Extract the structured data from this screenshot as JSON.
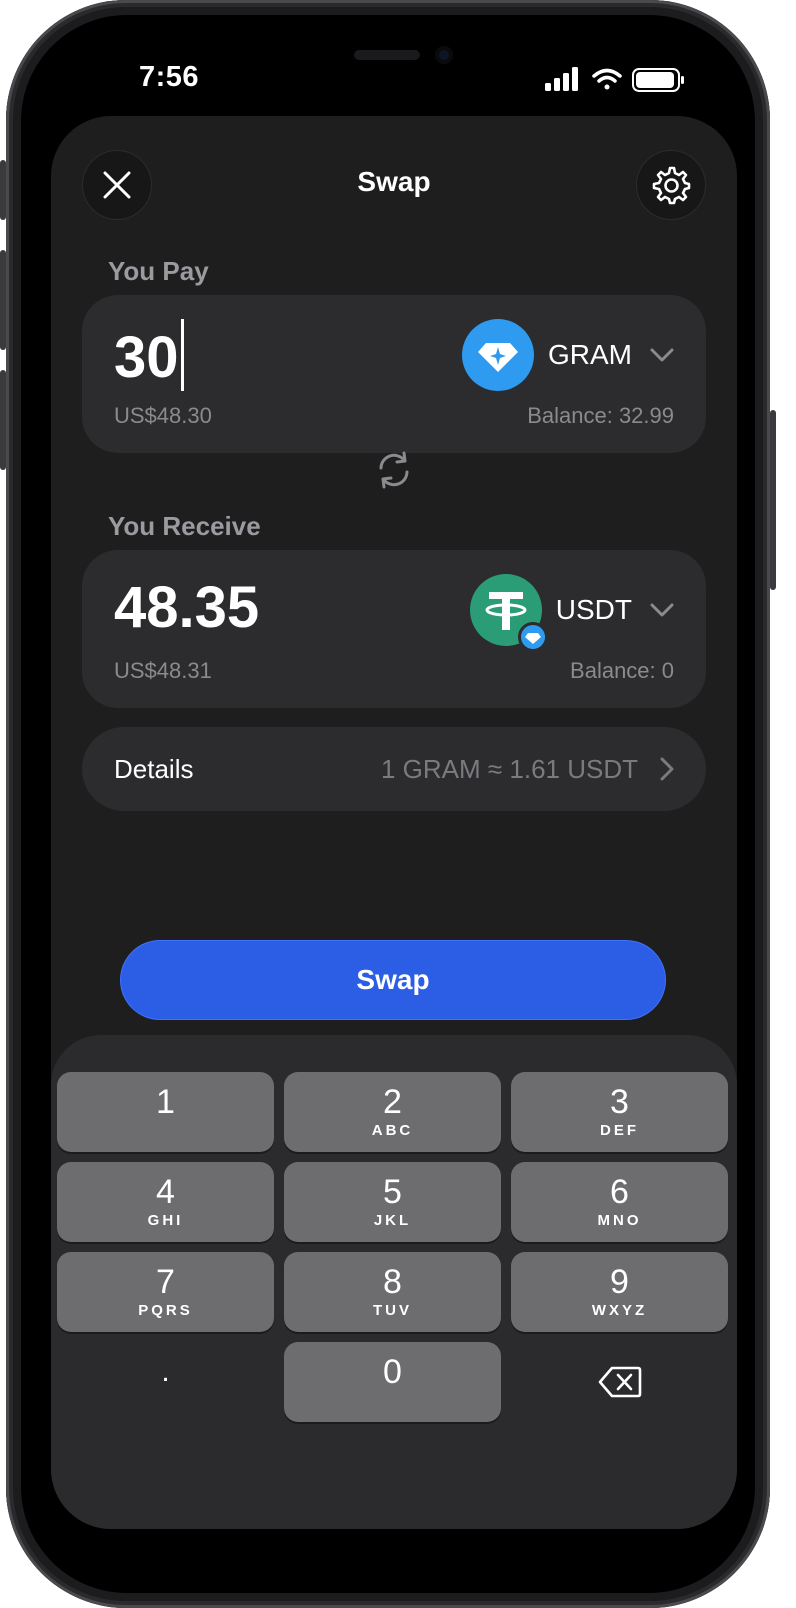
{
  "status_bar": {
    "time": "7:56"
  },
  "header": {
    "title": "Swap",
    "close_icon": "close-icon",
    "settings_icon": "gear-icon"
  },
  "pay": {
    "label": "You Pay",
    "amount": "30",
    "fiat": "US$48.30",
    "token": "GRAM",
    "balance": "Balance: 32.99"
  },
  "receive": {
    "label": "You Receive",
    "amount": "48.35",
    "fiat": "US$48.31",
    "token": "USDT",
    "balance": "Balance: 0"
  },
  "details": {
    "label": "Details",
    "rate": "1 GRAM ≈ 1.61 USDT"
  },
  "swap_button": {
    "label": "Swap"
  },
  "keypad": {
    "keys": [
      {
        "num": "1",
        "letters": ""
      },
      {
        "num": "2",
        "letters": "ABC"
      },
      {
        "num": "3",
        "letters": "DEF"
      },
      {
        "num": "4",
        "letters": "GHI"
      },
      {
        "num": "5",
        "letters": "JKL"
      },
      {
        "num": "6",
        "letters": "MNO"
      },
      {
        "num": "7",
        "letters": "PQRS"
      },
      {
        "num": "8",
        "letters": "TUV"
      },
      {
        "num": "9",
        "letters": "WXYZ"
      },
      {
        "num": ".",
        "letters": ""
      },
      {
        "num": "0",
        "letters": ""
      }
    ],
    "backspace_icon": "backspace-icon"
  },
  "colors": {
    "accent": "#2c5de5",
    "gram": "#2e9bf0",
    "usdt": "#2a9d77"
  }
}
